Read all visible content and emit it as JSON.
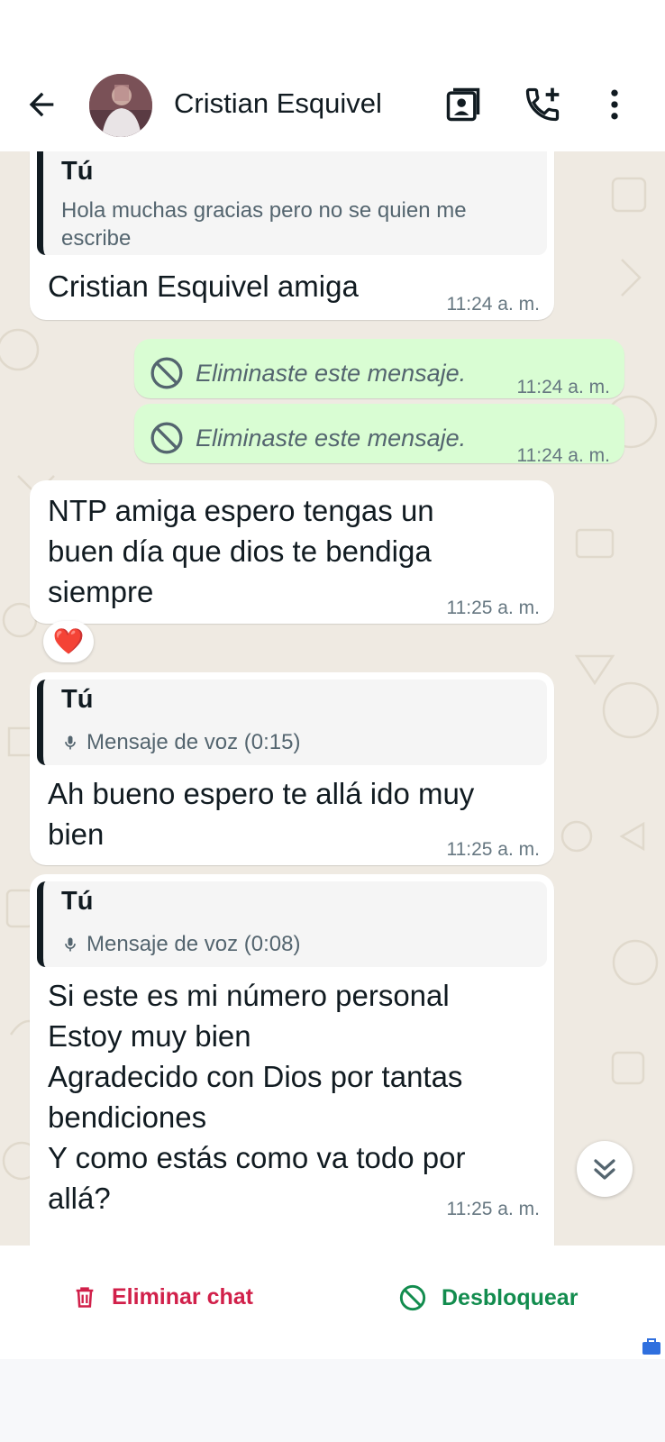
{
  "header": {
    "contact_name": "Cristian Esquivel"
  },
  "messages": [
    {
      "type": "incoming-reply",
      "quote_author": "Tú",
      "quote_text": "Hola muchas gracias pero no se quien me escribe",
      "text": "Cristian Esquivel amiga",
      "time": "11:24 a. m."
    },
    {
      "type": "outgoing-deleted",
      "text": "Eliminaste este mensaje.",
      "time": "11:24 a. m."
    },
    {
      "type": "outgoing-deleted",
      "text": "Eliminaste este mensaje.",
      "time": "11:24 a. m."
    },
    {
      "type": "incoming",
      "text": "NTP amiga espero tengas un\nbuen día que dios te bendiga\nsiempre",
      "time": "11:25 a. m.",
      "reaction": "❤️"
    },
    {
      "type": "incoming-reply",
      "quote_author": "Tú",
      "quote_text": "Mensaje de voz (0:15)",
      "text": "Ah bueno espero te allá ido muy\nbien",
      "time": "11:25 a. m."
    },
    {
      "type": "incoming-reply",
      "quote_author": "Tú",
      "quote_text": "Mensaje de voz (0:08)",
      "text": "Si este es mi número personal\nEstoy muy bien\nAgradecido con Dios por tantas\nbendiciones\nY como estás como va todo por\nallá?",
      "time": "11:25 a. m."
    }
  ],
  "actions": {
    "delete_chat": "Eliminar chat",
    "unblock": "Desbloquear"
  },
  "icons": {
    "back": "arrow-left-icon",
    "contact_card": "contact-card-icon",
    "add_call": "phone-plus-icon",
    "menu": "more-vertical-icon",
    "deleted": "blocked-circle-icon",
    "voice": "microphone-icon",
    "scroll": "double-chevron-down-icon",
    "trash": "trash-icon",
    "unblock": "blocked-circle-icon"
  },
  "colors": {
    "chat_background": "#efeae2",
    "outgoing_bubble": "#d9fdd3",
    "delete_red": "#d1204a",
    "unblock_green": "#128c4e"
  }
}
